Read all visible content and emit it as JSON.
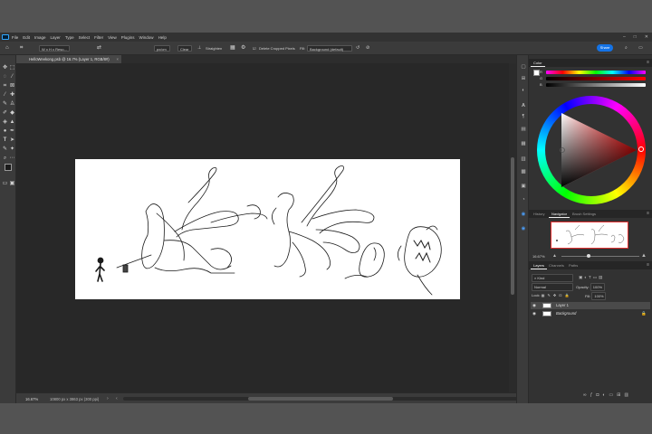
{
  "menu": {
    "items": [
      "File",
      "Edit",
      "Image",
      "Layer",
      "Type",
      "Select",
      "Filter",
      "View",
      "Plugins",
      "Window",
      "Help"
    ]
  },
  "options": {
    "ratio": "W x H x Reso...",
    "units": "px/cm",
    "clear_label": "Clear",
    "straighten_label": "Straighten",
    "delete_cropped_label": "Delete Cropped Pixels",
    "fill_label": "Fill:",
    "fill_value": "Background (default)",
    "share_label": "Share"
  },
  "document": {
    "tab_title": "HelloWeekong.psb @ 16.7% (Layer 1, RGB/8#)",
    "zoom": "16.67%",
    "info": "10800 px x 3863 px (300 ppi)"
  },
  "color_panel": {
    "title": "Color",
    "slider_labels": [
      "R",
      "G",
      "B"
    ],
    "hue_color": "#ff0000",
    "selected_color": "#ffffff"
  },
  "navigator": {
    "tabs": [
      "History",
      "Navigator",
      "Brush Settings"
    ],
    "zoom": "16.67%"
  },
  "layers": {
    "tabs": [
      "Layers",
      "Channels",
      "Paths"
    ],
    "kind_label": "Kind",
    "blend_mode": "Normal",
    "opacity_label": "Opacity:",
    "opacity_value": "100%",
    "lock_label": "Lock:",
    "fill_label": "Fill:",
    "fill_value": "100%",
    "items": [
      {
        "name": "Layer 1"
      },
      {
        "name": "Background"
      }
    ]
  }
}
